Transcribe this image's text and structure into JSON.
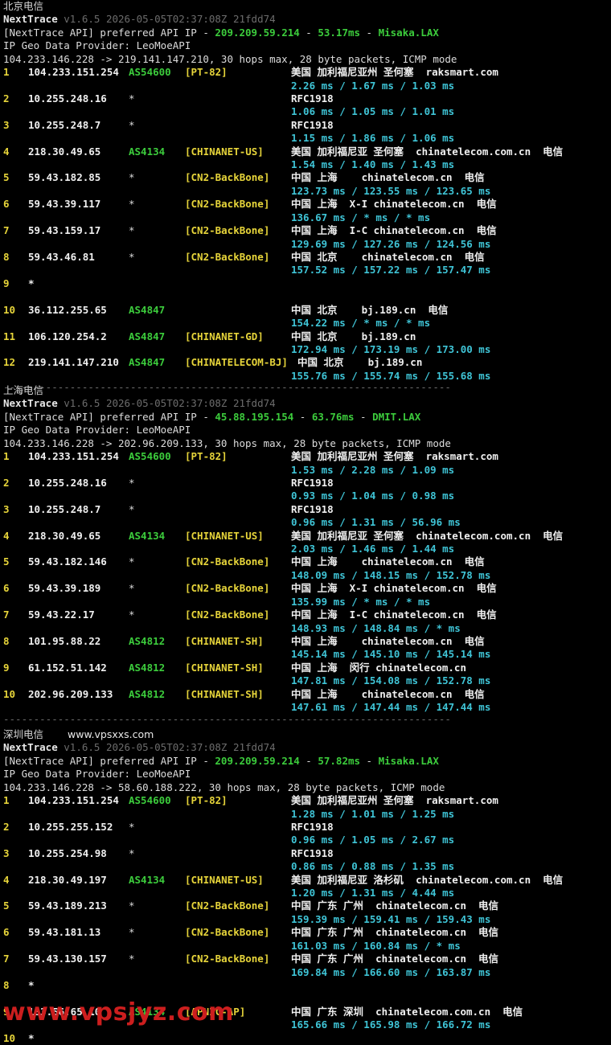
{
  "sections": [
    {
      "title": "北京电信",
      "site": "",
      "nexttrace": "NextTrace",
      "version": "v1.6.5 2026-05-05T02:37:08Z 21fdd74",
      "api_prefix": "[NextTrace API] preferred API IP - ",
      "api_ip": "209.209.59.214",
      "api_dash": " - ",
      "api_ms": "53.17ms",
      "api_node": "Misaka.LAX",
      "geo": "IP Geo Data Provider: LeoMoeAPI",
      "route": "104.233.146.228 -> 219.141.147.210, 30 hops max, 28 byte packets, ICMP mode",
      "hops": [
        {
          "n": "1",
          "ip": "104.233.151.254",
          "as": "AS54600",
          "tag": "[PT-82]",
          "geo": "美国 加利福尼亚州 圣何塞  raksmart.com",
          "rtt": "2.26 ms / 1.67 ms / 1.03 ms"
        },
        {
          "n": "2",
          "ip": "10.255.248.16",
          "as": "*",
          "tag": "",
          "geo": "RFC1918",
          "rtt": "1.06 ms / 1.05 ms / 1.01 ms"
        },
        {
          "n": "3",
          "ip": "10.255.248.7",
          "as": "*",
          "tag": "",
          "geo": "RFC1918",
          "rtt": "1.15 ms / 1.86 ms / 1.06 ms"
        },
        {
          "n": "4",
          "ip": "218.30.49.65",
          "as": "AS4134",
          "tag": "[CHINANET-US]",
          "geo": "美国 加利福尼亚 圣何塞  chinatelecom.com.cn  电信",
          "rtt": "1.54 ms / 1.40 ms / 1.43 ms"
        },
        {
          "n": "5",
          "ip": "59.43.182.85",
          "as": "*",
          "tag": "[CN2-BackBone]",
          "geo": "中国 上海    chinatelecom.cn  电信",
          "rtt": "123.73 ms / 123.55 ms / 123.65 ms"
        },
        {
          "n": "6",
          "ip": "59.43.39.117",
          "as": "*",
          "tag": "[CN2-BackBone]",
          "geo": "中国 上海  X-I chinatelecom.cn  电信",
          "rtt": "136.67 ms / * ms / * ms"
        },
        {
          "n": "7",
          "ip": "59.43.159.17",
          "as": "*",
          "tag": "[CN2-BackBone]",
          "geo": "中国 上海  I-C chinatelecom.cn  电信",
          "rtt": "129.69 ms / 127.26 ms / 124.56 ms"
        },
        {
          "n": "8",
          "ip": "59.43.46.81",
          "as": "*",
          "tag": "[CN2-BackBone]",
          "geo": "中国 北京    chinatelecom.cn  电信",
          "rtt": "157.52 ms / 157.22 ms / 157.47 ms"
        },
        {
          "n": "9",
          "ip": "*",
          "as": "",
          "tag": "",
          "geo": "",
          "rtt": ""
        },
        {
          "n": "10",
          "ip": "36.112.255.65",
          "as": "AS4847",
          "tag": "",
          "geo": "中国 北京    bj.189.cn  电信",
          "rtt": "154.22 ms / * ms / * ms"
        },
        {
          "n": "11",
          "ip": "106.120.254.2",
          "as": "AS4847",
          "tag": "[CHINANET-GD]",
          "geo": "中国 北京    bj.189.cn",
          "rtt": "172.94 ms / 173.19 ms / 173.00 ms"
        },
        {
          "n": "12",
          "ip": "219.141.147.210",
          "as": "AS4847",
          "tag": "[CHINATELECOM-BJ]",
          "geo": "中国 北京    bj.189.cn",
          "rtt": "155.76 ms / 155.74 ms / 155.68 ms"
        }
      ]
    },
    {
      "title": "上海电信",
      "site": "",
      "nexttrace": "NextTrace",
      "version": "v1.6.5 2026-05-05T02:37:08Z 21fdd74",
      "api_prefix": "[NextTrace API] preferred API IP - ",
      "api_ip": "45.88.195.154",
      "api_dash": " - ",
      "api_ms": "63.76ms",
      "api_node": "DMIT.LAX",
      "geo": "IP Geo Data Provider: LeoMoeAPI",
      "route": "104.233.146.228 -> 202.96.209.133, 30 hops max, 28 byte packets, ICMP mode",
      "hops": [
        {
          "n": "1",
          "ip": "104.233.151.254",
          "as": "AS54600",
          "tag": "[PT-82]",
          "geo": "美国 加利福尼亚州 圣何塞  raksmart.com",
          "rtt": "1.53 ms / 2.28 ms / 1.09 ms"
        },
        {
          "n": "2",
          "ip": "10.255.248.16",
          "as": "*",
          "tag": "",
          "geo": "RFC1918",
          "rtt": "0.93 ms / 1.04 ms / 0.98 ms"
        },
        {
          "n": "3",
          "ip": "10.255.248.7",
          "as": "*",
          "tag": "",
          "geo": "RFC1918",
          "rtt": "0.96 ms / 1.31 ms / 56.96 ms"
        },
        {
          "n": "4",
          "ip": "218.30.49.65",
          "as": "AS4134",
          "tag": "[CHINANET-US]",
          "geo": "美国 加利福尼亚 圣何塞  chinatelecom.com.cn  电信",
          "rtt": "2.03 ms / 1.46 ms / 1.44 ms"
        },
        {
          "n": "5",
          "ip": "59.43.182.146",
          "as": "*",
          "tag": "[CN2-BackBone]",
          "geo": "中国 上海    chinatelecom.cn  电信",
          "rtt": "148.09 ms / 148.15 ms / 152.78 ms"
        },
        {
          "n": "6",
          "ip": "59.43.39.189",
          "as": "*",
          "tag": "[CN2-BackBone]",
          "geo": "中国 上海  X-I chinatelecom.cn  电信",
          "rtt": "135.99 ms / * ms / * ms"
        },
        {
          "n": "7",
          "ip": "59.43.22.17",
          "as": "*",
          "tag": "[CN2-BackBone]",
          "geo": "中国 上海  I-C chinatelecom.cn  电信",
          "rtt": "148.93 ms / 148.84 ms / * ms"
        },
        {
          "n": "8",
          "ip": "101.95.88.22",
          "as": "AS4812",
          "tag": "[CHINANET-SH]",
          "geo": "中国 上海    chinatelecom.cn  电信",
          "rtt": "145.14 ms / 145.10 ms / 145.14 ms"
        },
        {
          "n": "9",
          "ip": "61.152.51.142",
          "as": "AS4812",
          "tag": "[CHINANET-SH]",
          "geo": "中国 上海  闵行 chinatelecom.cn",
          "rtt": "147.81 ms / 154.08 ms / 152.78 ms"
        },
        {
          "n": "10",
          "ip": "202.96.209.133",
          "as": "AS4812",
          "tag": "[CHINANET-SH]",
          "geo": "中国 上海    chinatelecom.cn  电信",
          "rtt": "147.61 ms / 147.44 ms / 147.44 ms"
        }
      ]
    },
    {
      "title": "深圳电信",
      "site": "www.vpsxxs.com",
      "nexttrace": "NextTrace",
      "version": "v1.6.5 2026-05-05T02:37:08Z 21fdd74",
      "api_prefix": "[NextTrace API] preferred API IP - ",
      "api_ip": "209.209.59.214",
      "api_dash": " - ",
      "api_ms": "57.82ms",
      "api_node": "Misaka.LAX",
      "geo": "IP Geo Data Provider: LeoMoeAPI",
      "route": "104.233.146.228 -> 58.60.188.222, 30 hops max, 28 byte packets, ICMP mode",
      "hops": [
        {
          "n": "1",
          "ip": "104.233.151.254",
          "as": "AS54600",
          "tag": "[PT-82]",
          "geo": "美国 加利福尼亚州 圣何塞  raksmart.com",
          "rtt": "1.28 ms / 1.01 ms / 1.25 ms"
        },
        {
          "n": "2",
          "ip": "10.255.255.152",
          "as": "*",
          "tag": "",
          "geo": "RFC1918",
          "rtt": "0.96 ms / 1.05 ms / 2.67 ms"
        },
        {
          "n": "3",
          "ip": "10.255.254.98",
          "as": "*",
          "tag": "",
          "geo": "RFC1918",
          "rtt": "0.86 ms / 0.88 ms / 1.35 ms"
        },
        {
          "n": "4",
          "ip": "218.30.49.197",
          "as": "AS4134",
          "tag": "[CHINANET-US]",
          "geo": "美国 加利福尼亚 洛杉矶  chinatelecom.com.cn  电信",
          "rtt": "1.20 ms / 1.31 ms / 4.44 ms"
        },
        {
          "n": "5",
          "ip": "59.43.189.213",
          "as": "*",
          "tag": "[CN2-BackBone]",
          "geo": "中国 广东 广州  chinatelecom.cn  电信",
          "rtt": "159.39 ms / 159.41 ms / 159.43 ms"
        },
        {
          "n": "6",
          "ip": "59.43.181.13",
          "as": "*",
          "tag": "[CN2-BackBone]",
          "geo": "中国 广东 广州  chinatelecom.cn  电信",
          "rtt": "161.03 ms / 160.84 ms / * ms"
        },
        {
          "n": "7",
          "ip": "59.43.130.157",
          "as": "*",
          "tag": "[CN2-BackBone]",
          "geo": "中国 广东 广州  chinatelecom.cn  电信",
          "rtt": "169.84 ms / 166.60 ms / 163.87 ms"
        },
        {
          "n": "8",
          "ip": "*",
          "as": "",
          "tag": "",
          "geo": "",
          "rtt": ""
        },
        {
          "n": "9",
          "ip": "183.56.65.10",
          "as": "AS4134",
          "tag": "[APNIC-AP]",
          "geo": "中国 广东 深圳  chinatelecom.com.cn  电信",
          "rtt": "165.66 ms / 165.98 ms / 166.72 ms"
        },
        {
          "n": "10",
          "ip": "*",
          "as": "",
          "tag": "",
          "geo": "",
          "rtt": ""
        }
      ]
    }
  ],
  "separator": "--------------------------------------------------------------------------",
  "watermark": "www.vpsjyz.com",
  "colors": {
    "background": "#000000",
    "green": "#3ccc3c",
    "yellow": "#e6d43a",
    "cyan": "#3fc4d6",
    "watermark": "#cc1e1e"
  }
}
